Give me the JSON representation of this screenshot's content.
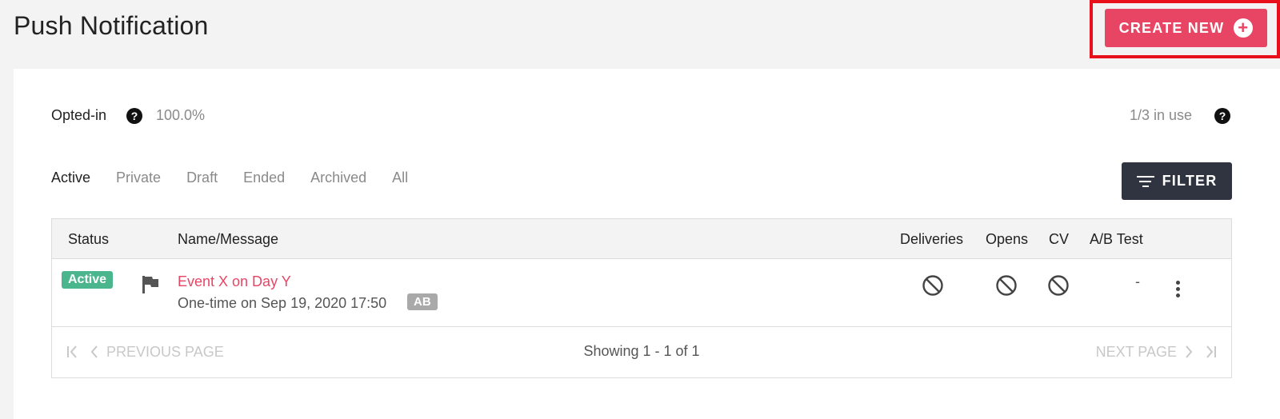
{
  "page": {
    "title": "Push Notification",
    "create_label": "CREATE NEW",
    "create_icon": "plus-circle-icon"
  },
  "stats": {
    "opted_label": "Opted-in",
    "opted_value": "100.0%",
    "in_use": "1/3 in use",
    "help_icon": "question-circle-icon",
    "help_glyph": "?"
  },
  "tabs": [
    {
      "label": "Active",
      "active": true
    },
    {
      "label": "Private",
      "active": false
    },
    {
      "label": "Draft",
      "active": false
    },
    {
      "label": "Ended",
      "active": false
    },
    {
      "label": "Archived",
      "active": false
    },
    {
      "label": "All",
      "active": false
    }
  ],
  "filter": {
    "label": "FILTER",
    "icon": "filter-icon"
  },
  "table": {
    "headers": {
      "status": "Status",
      "name": "Name/Message",
      "deliveries": "Deliveries",
      "opens": "Opens",
      "cv": "CV",
      "ab": "A/B Test"
    },
    "rows": [
      {
        "status": "Active",
        "name": "Event X on Day Y",
        "schedule": "One-time on Sep 19, 2020 17:50",
        "tag": "AB",
        "deliveries_icon": "not-available-icon",
        "opens_icon": "not-available-icon",
        "cv_icon": "not-available-icon",
        "ab_value": "-"
      }
    ]
  },
  "pager": {
    "prev_label": "PREVIOUS PAGE",
    "next_label": "NEXT PAGE",
    "info": "Showing 1 - 1 of 1"
  },
  "colors": {
    "accent": "#e84564",
    "highlight": "#e8101b",
    "status_active": "#4bb58d",
    "filter_bg": "#2f3440"
  }
}
